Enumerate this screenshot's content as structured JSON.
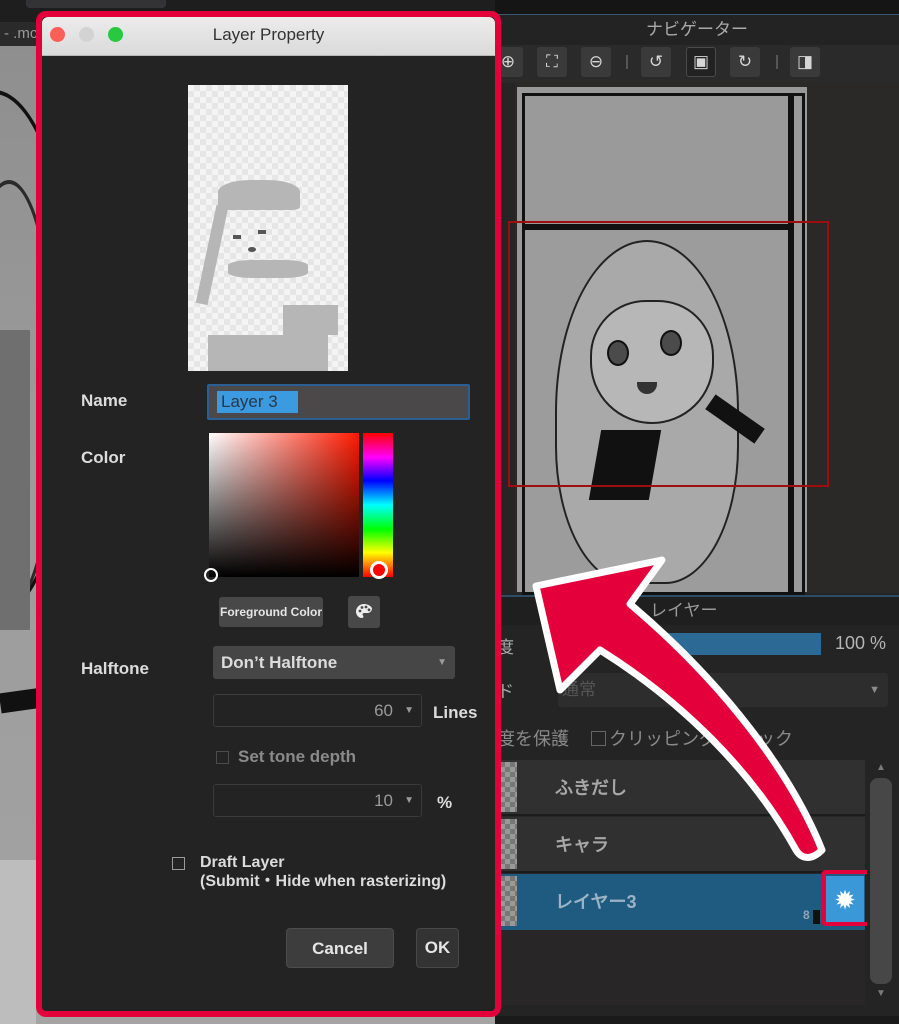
{
  "background_document": {
    "tab_label": "- .mc"
  },
  "dialog": {
    "title": "Layer Property",
    "name_label": "Name",
    "name_value": "Layer 3",
    "color_label": "Color",
    "selected_color": "#ff0000",
    "foreground_color_button": "Foreground Color",
    "palette_icon": "palette-icon",
    "halftone_label": "Halftone",
    "halftone_selected": "Don’t Halftone",
    "lines_value": "60",
    "lines_unit": "Lines",
    "set_tone_depth_label": "Set tone depth",
    "set_tone_depth_checked": false,
    "tone_depth_value": "10",
    "tone_depth_unit": "%",
    "draft_layer_label": "Draft Layer",
    "draft_layer_sublabel": "(Submit・Hide when rasterizing)",
    "draft_layer_checked": false,
    "cancel_label": "Cancel",
    "ok_label": "OK"
  },
  "navigator": {
    "title": "ナビゲーター",
    "toolbar": [
      {
        "icon": "zoom-in-icon",
        "glyph": "⊕"
      },
      {
        "icon": "fit-screen-icon",
        "glyph": "⛶"
      },
      {
        "icon": "zoom-out-icon",
        "glyph": "⊖"
      },
      {
        "icon": "rotate-left-icon",
        "glyph": "↺"
      },
      {
        "icon": "reset-view-icon",
        "glyph": "▣"
      },
      {
        "icon": "rotate-right-icon",
        "glyph": "↻"
      },
      {
        "icon": "flip-horizontal-icon",
        "glyph": "◨"
      }
    ]
  },
  "layer_panel": {
    "title": "レイヤー",
    "opacity_label": "度",
    "opacity_percent": 100,
    "opacity_text": "100 %",
    "blend_label": "ド",
    "blend_value": "通常",
    "protect_label": "度を保護",
    "clipping_label": "クリッピング",
    "lock_label": "ロック",
    "layers": [
      {
        "name": "ふきだし",
        "selected": false
      },
      {
        "name": "キャラ",
        "selected": false
      },
      {
        "name": "レイヤー3",
        "selected": true,
        "bit_depth": "8"
      }
    ],
    "gear_icon": "gear-icon"
  },
  "colors": {
    "highlight": "#e4003a",
    "selection_blue": "#1f5b80",
    "gear_blue": "#3a97d8"
  }
}
